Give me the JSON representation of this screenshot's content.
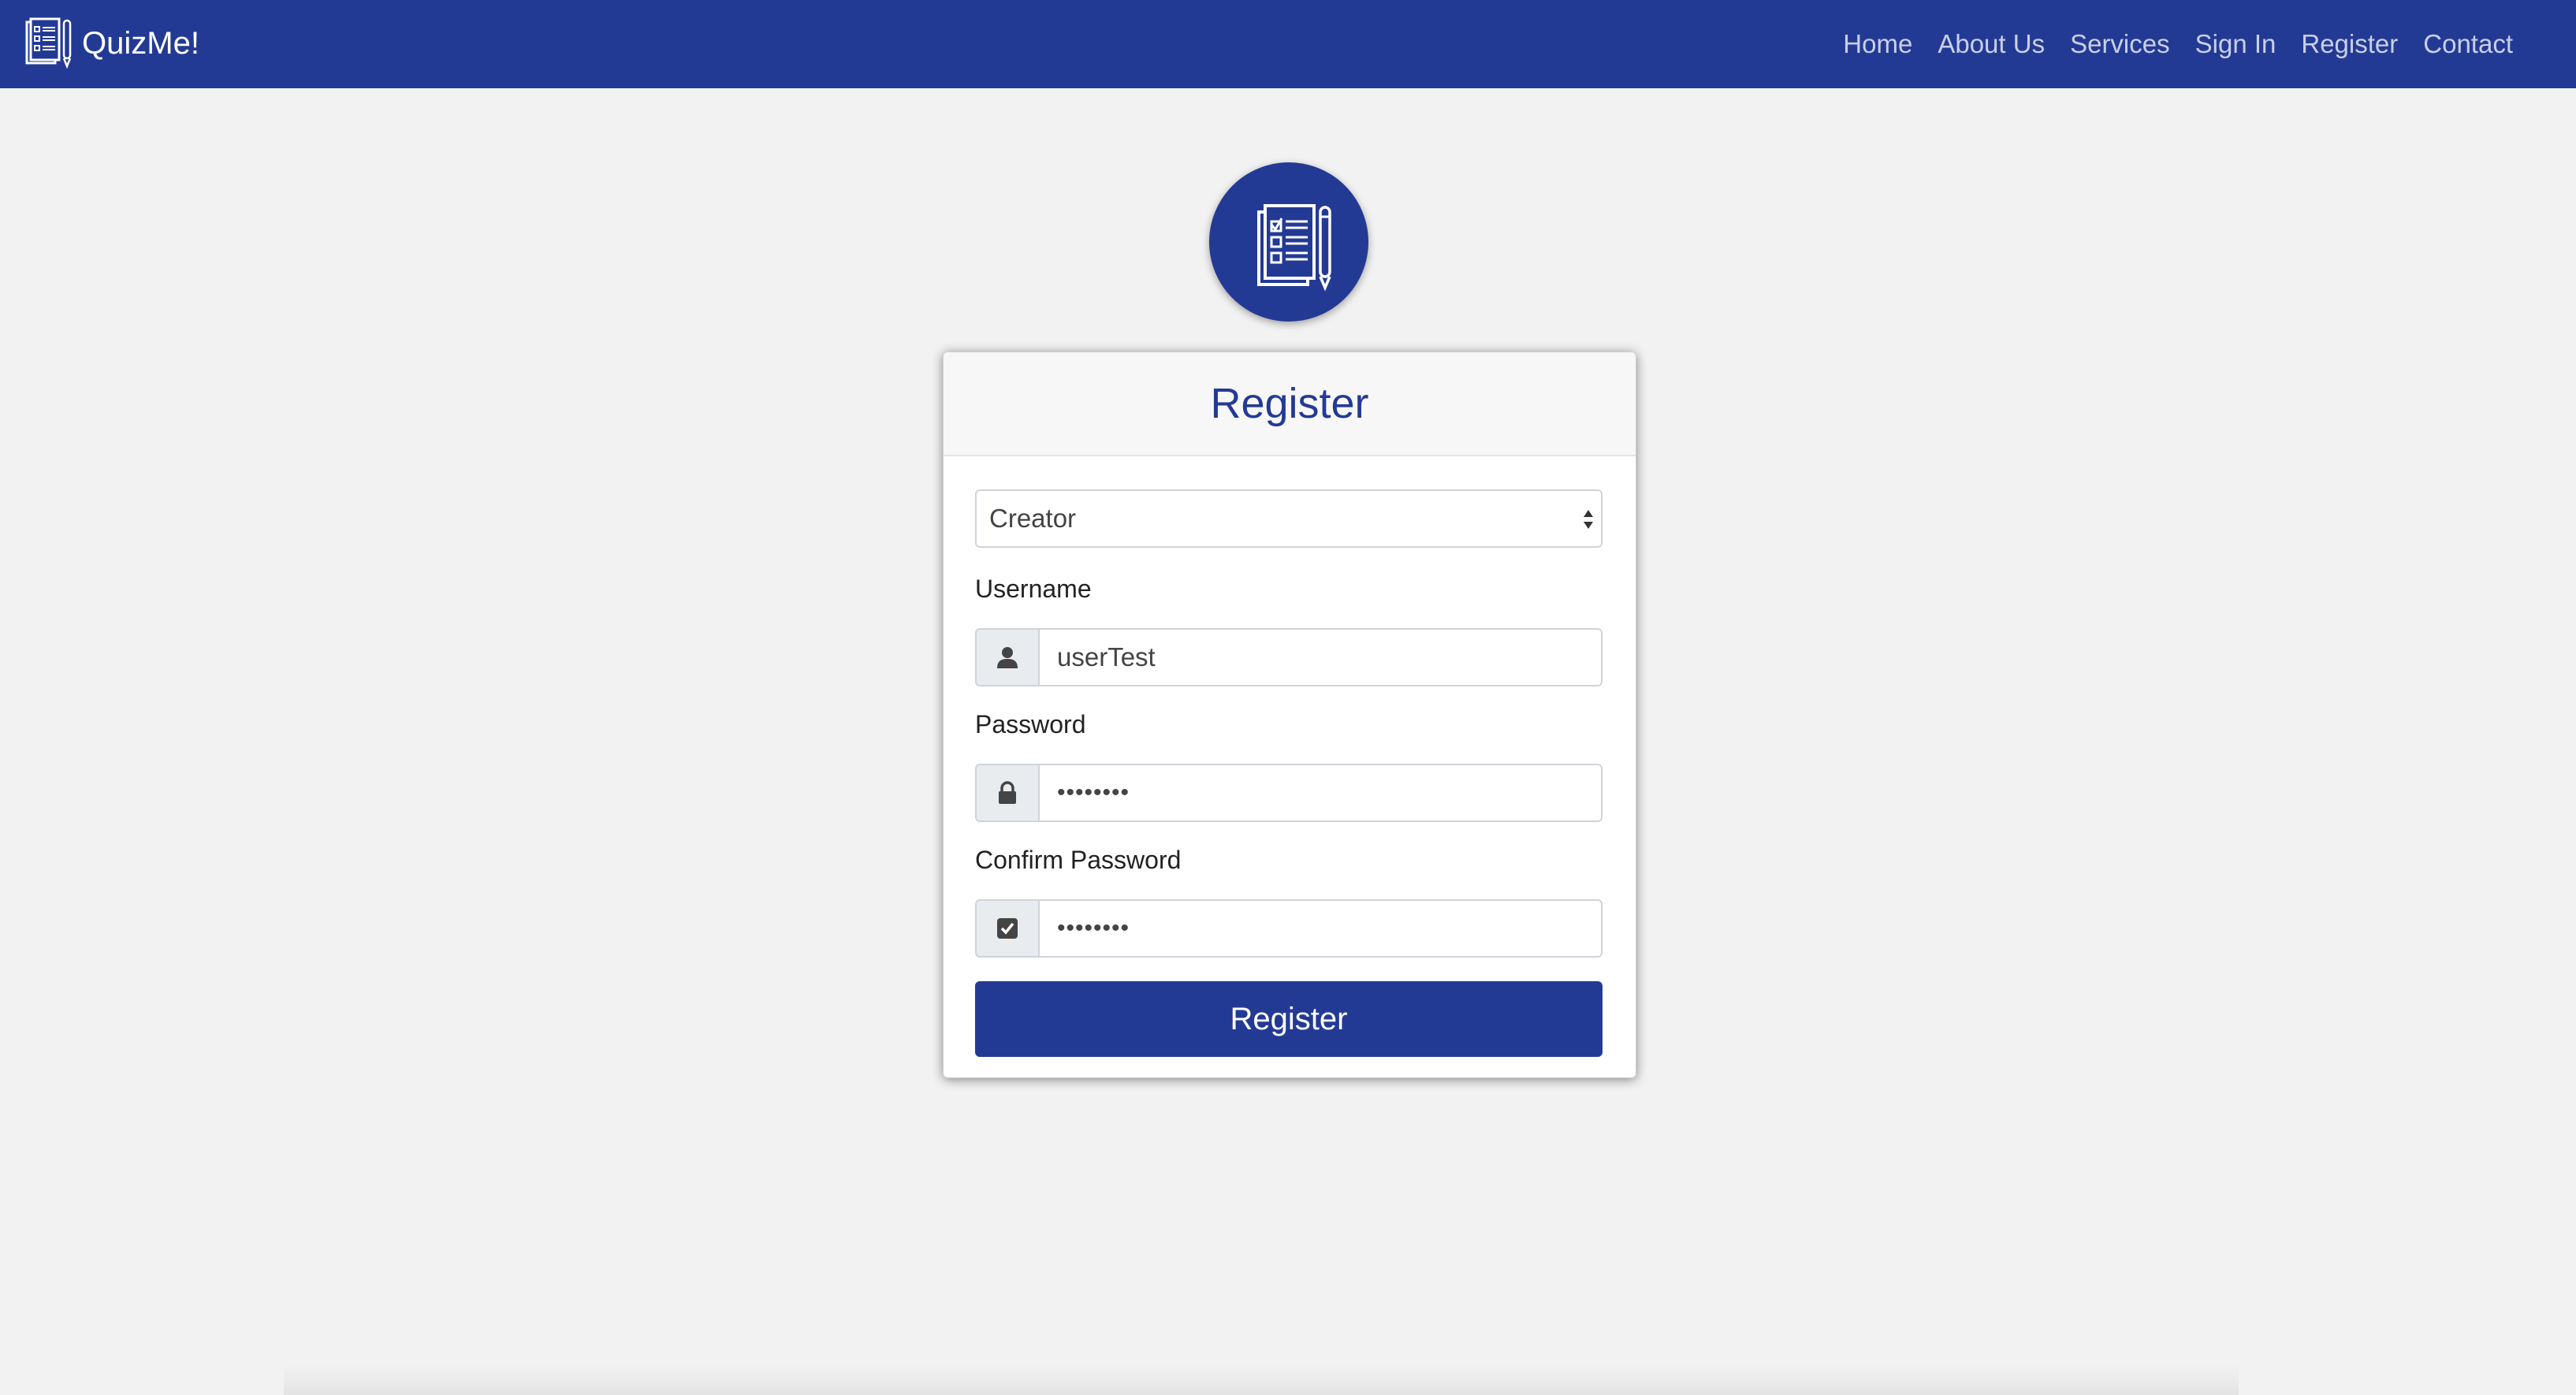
{
  "navbar": {
    "brand": "QuizMe!",
    "links": [
      "Home",
      "About Us",
      "Services",
      "Sign In",
      "Register",
      "Contact"
    ]
  },
  "card": {
    "title": "Register",
    "role_select": {
      "value": "Creator"
    },
    "username": {
      "label": "Username",
      "value": "userTest"
    },
    "password": {
      "label": "Password",
      "value": "••••••••"
    },
    "confirm_password": {
      "label": "Confirm Password",
      "value": "••••••••"
    },
    "submit_label": "Register"
  },
  "icons": {
    "brand": "quiz-clipboard-icon",
    "avatar": "quiz-clipboard-icon",
    "username": "user-icon",
    "password": "lock-icon",
    "confirm": "check-square-icon"
  },
  "colors": {
    "primary": "#233a95",
    "background": "#f2f2f2"
  }
}
